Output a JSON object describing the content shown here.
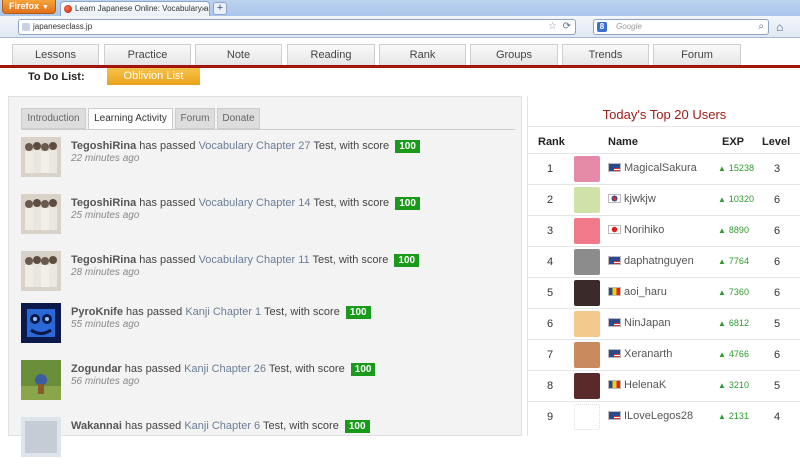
{
  "browser": {
    "menu_label": "Firefox",
    "tab_title": "Learn Japanese Online: Vocabulary and ...",
    "new_tab_symbol": "+",
    "url": "japaneseclass.jp",
    "search_placeholder": "Google",
    "search_engine_letter": "8"
  },
  "nav": {
    "tabs": [
      "Lessons",
      "Practice",
      "Note",
      "Reading",
      "Rank",
      "Groups",
      "Trends",
      "Forum"
    ]
  },
  "subnav": {
    "todo_label": "To Do List:",
    "oblivion_label": "Oblivion List"
  },
  "panel_tabs": [
    "Introduction",
    "Learning Activity",
    "Forum",
    "Donate"
  ],
  "feed": [
    {
      "user": "TegoshiRina",
      "text1": " has passed ",
      "chapter": "Vocabulary Chapter 27",
      "text2": " Test, with score ",
      "score": "100",
      "time": "22 minutes ago",
      "thumb": "group"
    },
    {
      "user": "TegoshiRina",
      "text1": " has passed ",
      "chapter": "Vocabulary Chapter 14",
      "text2": " Test, with score ",
      "score": "100",
      "time": "25 minutes ago",
      "thumb": "group"
    },
    {
      "user": "TegoshiRina",
      "text1": " has passed ",
      "chapter": "Vocabulary Chapter 11",
      "text2": " Test, with score ",
      "score": "100",
      "time": "28 minutes ago",
      "thumb": "group"
    },
    {
      "user": "PyroKnife",
      "text1": " has passed ",
      "chapter": "Kanji Chapter 1",
      "text2": " Test, with score ",
      "score": "100",
      "time": "55 minutes ago",
      "thumb": "blue"
    },
    {
      "user": "Zogundar",
      "text1": " has passed ",
      "chapter": "Kanji Chapter 26",
      "text2": " Test, with score ",
      "score": "100",
      "time": "56 minutes ago",
      "thumb": "nature"
    },
    {
      "user": "Wakannai",
      "text1": " has passed ",
      "chapter": "Kanji Chapter 6",
      "text2": " Test, with score ",
      "score": "100",
      "time": "",
      "thumb": "partial"
    }
  ],
  "leaderboard": {
    "title": "Today's Top 20 Users",
    "headers": {
      "rank": "Rank",
      "name": "Name",
      "exp": "EXP",
      "level": "Level"
    },
    "rows": [
      {
        "rank": "1",
        "name": "MagicalSakura",
        "exp": "15238",
        "level": "3",
        "flag": "us",
        "avatar": "#e58aa6"
      },
      {
        "rank": "2",
        "name": "kjwkjw",
        "exp": "10320",
        "level": "6",
        "flag": "kr",
        "avatar": "#cfe3a8"
      },
      {
        "rank": "3",
        "name": "Norihiko",
        "exp": "8890",
        "level": "6",
        "flag": "jp",
        "avatar": "#f07a8a"
      },
      {
        "rank": "4",
        "name": "daphatnguyen",
        "exp": "7764",
        "level": "6",
        "flag": "us",
        "avatar": "#8c8c8c"
      },
      {
        "rank": "5",
        "name": "aoi_haru",
        "exp": "7360",
        "level": "6",
        "flag": "ro",
        "avatar": "#3b2a2a"
      },
      {
        "rank": "6",
        "name": "NinJapan",
        "exp": "6812",
        "level": "5",
        "flag": "us",
        "avatar": "#f4c98e"
      },
      {
        "rank": "7",
        "name": "Xeranarth",
        "exp": "4766",
        "level": "6",
        "flag": "us",
        "avatar": "#c98a5e"
      },
      {
        "rank": "8",
        "name": "HelenaK",
        "exp": "3210",
        "level": "5",
        "flag": "ro",
        "avatar": "#5a2a2a"
      },
      {
        "rank": "9",
        "name": "ILoveLegos28",
        "exp": "2131",
        "level": "4",
        "flag": "us",
        "avatar": "#ffffff"
      }
    ]
  }
}
